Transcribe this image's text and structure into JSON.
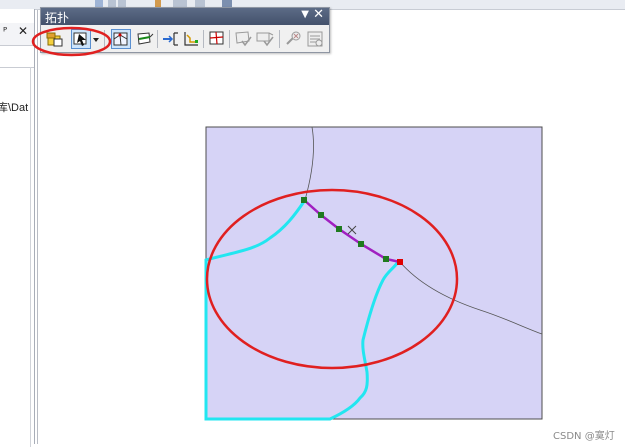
{
  "toolbar": {
    "title": "拓扑",
    "dropdown_glyph": "▼",
    "close_glyph": "✕",
    "buttons": [
      {
        "name": "topology-select-button",
        "icon": "topology-db-icon"
      },
      {
        "name": "topology-edit-tool-button",
        "icon": "topology-edit-arrow-icon",
        "pressed": true
      },
      {
        "name": "topology-edit-dropdown-button",
        "icon": "dropdown-arrow-icon"
      },
      {
        "name": "map-topology-button",
        "icon": "map-topology-icon",
        "pressed": true
      },
      {
        "name": "show-shared-features-button",
        "icon": "shared-features-icon"
      },
      {
        "name": "align-edge-button",
        "icon": "align-edge-icon"
      },
      {
        "name": "modify-edge-button",
        "icon": "modify-edge-icon"
      },
      {
        "name": "construct-features-button",
        "icon": "construct-features-icon"
      },
      {
        "name": "validate-extent-button",
        "icon": "validate-extent-icon"
      },
      {
        "name": "validate-topology-button",
        "icon": "validate-topology-icon"
      },
      {
        "name": "fix-topology-error-button",
        "icon": "fix-error-icon"
      },
      {
        "name": "error-inspector-button",
        "icon": "error-inspector-icon"
      }
    ]
  },
  "left_panel": {
    "pin_glyph": "ᵖ",
    "close_glyph": "✕",
    "path_fragment": "库\\Dat"
  },
  "map": {
    "polygon_fill": "#d6d3f6",
    "polygon_border": "#4d4d4d",
    "boundary_line_color": "#555555",
    "selected_edge_color": "#a020c0",
    "cyan_line_color": "#22e6f0",
    "vertex_color": "#1f7a1f",
    "end_vertex_color": "#e00000",
    "annotation_color": "#e02020"
  },
  "watermark": "CSDN @寞灯"
}
